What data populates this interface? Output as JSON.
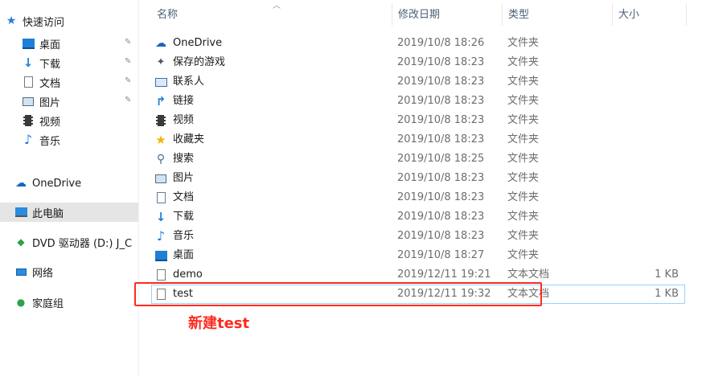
{
  "nav": {
    "quick_access": "快速访问",
    "items": [
      {
        "label": "桌面",
        "icon": "desktop-icon",
        "pinned": true
      },
      {
        "label": "下载",
        "icon": "download-arrow-icon",
        "pinned": true
      },
      {
        "label": "文档",
        "icon": "document-icon",
        "pinned": true
      },
      {
        "label": "图片",
        "icon": "pictures-icon",
        "pinned": true
      },
      {
        "label": "视频",
        "icon": "video-icon",
        "pinned": false
      },
      {
        "label": "音乐",
        "icon": "music-note-icon",
        "pinned": false
      }
    ],
    "onedrive": "OneDrive",
    "this_pc": "此电脑",
    "dvd": "DVD 驱动器 (D:) J_C",
    "network": "网络",
    "homegroup": "家庭组"
  },
  "columns": {
    "name": "名称",
    "date": "修改日期",
    "type": "类型",
    "size": "大小"
  },
  "files": [
    {
      "name": "OneDrive",
      "date": "2019/10/8 18:26",
      "type": "文件夹",
      "size": ""
    },
    {
      "name": "保存的游戏",
      "date": "2019/10/8 18:23",
      "type": "文件夹",
      "size": ""
    },
    {
      "name": "联系人",
      "date": "2019/10/8 18:23",
      "type": "文件夹",
      "size": ""
    },
    {
      "name": "链接",
      "date": "2019/10/8 18:23",
      "type": "文件夹",
      "size": ""
    },
    {
      "name": "视频",
      "date": "2019/10/8 18:23",
      "type": "文件夹",
      "size": ""
    },
    {
      "name": "收藏夹",
      "date": "2019/10/8 18:23",
      "type": "文件夹",
      "size": ""
    },
    {
      "name": "搜索",
      "date": "2019/10/8 18:25",
      "type": "文件夹",
      "size": ""
    },
    {
      "name": "图片",
      "date": "2019/10/8 18:23",
      "type": "文件夹",
      "size": ""
    },
    {
      "name": "文档",
      "date": "2019/10/8 18:23",
      "type": "文件夹",
      "size": ""
    },
    {
      "name": "下载",
      "date": "2019/10/8 18:23",
      "type": "文件夹",
      "size": ""
    },
    {
      "name": "音乐",
      "date": "2019/10/8 18:23",
      "type": "文件夹",
      "size": ""
    },
    {
      "name": "桌面",
      "date": "2019/10/8 18:27",
      "type": "文件夹",
      "size": ""
    },
    {
      "name": "demo",
      "date": "2019/12/11 19:21",
      "type": "文本文档",
      "size": "1 KB"
    },
    {
      "name": "test",
      "date": "2019/12/11 19:32",
      "type": "文本文档",
      "size": "1 KB"
    }
  ],
  "annotation": "新建test",
  "colors": {
    "header_text": "#4c607a",
    "annotation_red": "#ff2a1f",
    "selection_bg": "#e5e5e5",
    "hover_border": "#99d1ff"
  }
}
